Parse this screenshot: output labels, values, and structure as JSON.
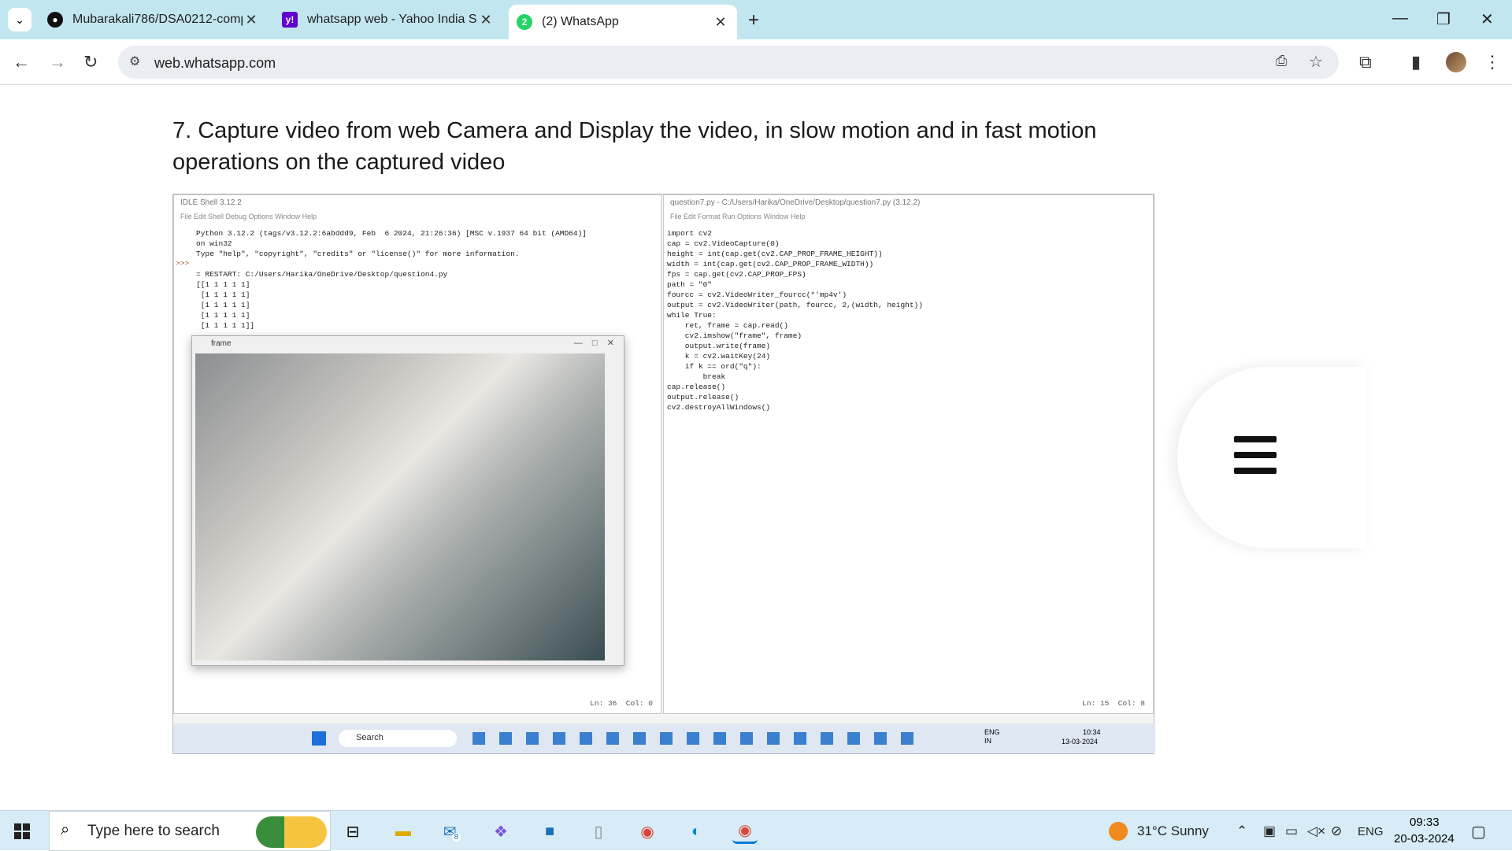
{
  "browser": {
    "tabs": [
      {
        "title": "Mubarakali786/DSA0212-comp",
        "icon": "github-icon"
      },
      {
        "title": "whatsapp web - Yahoo India Se",
        "icon": "yahoo-icon"
      },
      {
        "title": "(2) WhatsApp",
        "icon": "whatsapp-icon",
        "badge": "2"
      }
    ],
    "url": "web.whatsapp.com"
  },
  "page": {
    "heading": "7. Capture video from web Camera and Display the video, in slow motion and in fast motion operations on the captured video"
  },
  "screenshot": {
    "shell_title": "IDLE Shell 3.12.2",
    "shell_menu": "File   Edit   Shell   Debug   Options   Window   Help",
    "shell_lines": [
      "Python 3.12.2 (tags/v3.12.2:6abddd9, Feb  6 2024, 21:26:36) [MSC v.1937 64 bit (AMD64)]",
      "on win32",
      "Type \"help\", \"copyright\", \"credits\" or \"license()\" for more information.",
      "",
      "= RESTART: C:/Users/Harika/OneDrive/Desktop/question4.py",
      "[[1 1 1 1 1]",
      " [1 1 1 1 1]",
      " [1 1 1 1 1]",
      " [1 1 1 1 1]",
      " [1 1 1 1 1]]"
    ],
    "shell_status": "Ln: 36  Col: 0",
    "frame_title": "frame",
    "editor_title": "question7.py - C:/Users/Harika/OneDrive/Desktop/question7.py (3.12.2)",
    "editor_menu": "File   Edit   Format   Run   Options   Window   Help",
    "code_lines": [
      "import cv2",
      "cap = cv2.VideoCapture(0)",
      "height = int(cap.get(cv2.CAP_PROP_FRAME_HEIGHT))",
      "width = int(cap.get(cv2.CAP_PROP_FRAME_WIDTH))",
      "fps = cap.get(cv2.CAP_PROP_FPS)",
      "path = \"0\"",
      "fourcc = cv2.VideoWriter_fourcc(*'mp4v')",
      "output = cv2.VideoWriter(path, fourcc, 2,(width, height))",
      "while True:",
      "    ret, frame = cap.read()",
      "    cv2.imshow(\"frame\", frame)",
      "    output.write(frame)",
      "    k = cv2.waitKey(24)",
      "    if k == ord(\"q\"):",
      "        break",
      "cap.release()",
      "output.release()",
      "cv2.destroyAllWindows()"
    ],
    "editor_status": "Ln: 15  Col: 8",
    "inner_search": "Search",
    "inner_time": "10:34",
    "inner_date": "13-03-2024",
    "inner_lang": "ENG\nIN"
  },
  "taskbar": {
    "search_placeholder": "Type here to search",
    "mail_badge": "8",
    "weather": "31°C  Sunny",
    "lang": "ENG",
    "time": "09:33",
    "date": "20-03-2024"
  }
}
